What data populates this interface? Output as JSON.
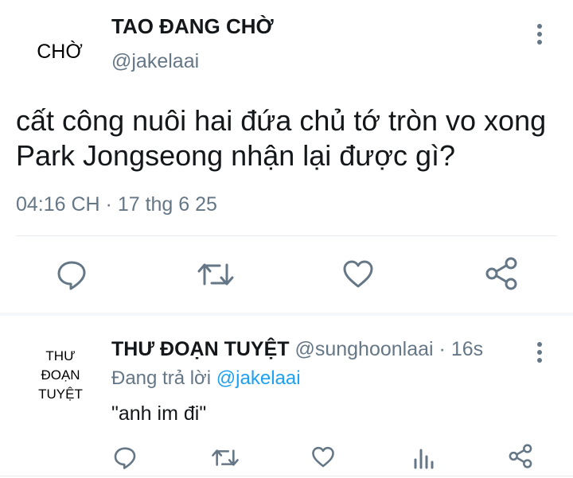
{
  "colors": {
    "accent": "#1da1f2",
    "text": "#14171a",
    "muted": "#657786",
    "divider": "#e6ecf0"
  },
  "tweet": {
    "avatar_text": "CHỜ",
    "display_name": "TAO ĐANG CHỜ",
    "handle": "@jakelaai",
    "text_line1": "cất công nuôi hai đứa chủ tớ tròn vo xong",
    "text_line2": "Park Jongseong nhận lại được gì?",
    "timestamp": "04:16 CH · 17 thg 6 25",
    "more_icon": "more-vertical-icon",
    "actions": [
      "reply-icon",
      "retweet-icon",
      "like-icon",
      "share-icon"
    ]
  },
  "reply": {
    "avatar_line1": "THƯ",
    "avatar_line2": "ĐOẠN",
    "avatar_line3": "TUYỆT",
    "display_name": "THƯ ĐOẠN TUYỆT",
    "handle": "@sunghoonlaai",
    "time": "· 16s",
    "replying_label": "Đang trả lời",
    "replying_to": "@jakelaai",
    "text": "\"anh im đi\"",
    "more_icon": "more-vertical-icon",
    "actions": [
      "reply-icon",
      "retweet-icon",
      "like-icon",
      "analytics-icon",
      "share-icon"
    ]
  }
}
